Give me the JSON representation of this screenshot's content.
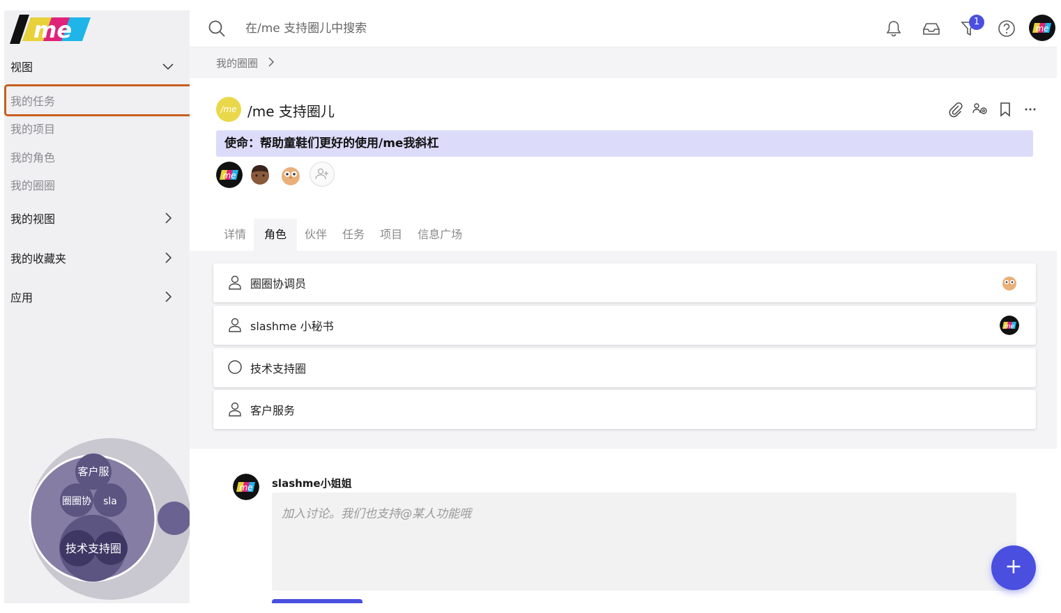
{
  "app": {
    "logo_text": "/me",
    "accent_color": "#4a4fe0",
    "highlight_color": "#c85f1e"
  },
  "sidebar": {
    "views_label": "视图",
    "items": [
      {
        "label": "我的任务"
      },
      {
        "label": "我的项目"
      },
      {
        "label": "我的角色"
      },
      {
        "label": "我的圈圈"
      }
    ],
    "my_views_label": "我的视图",
    "favorites_label": "我的收藏夹",
    "apps_label": "应用",
    "bubble_chart": {
      "labels": [
        "客户服",
        "圈圈协",
        "sla",
        "技术支持圈"
      ]
    }
  },
  "topbar": {
    "search_placeholder": "在/me 支持圈儿中搜索",
    "notification_count": "1",
    "icons": [
      "bell-icon",
      "inbox-icon",
      "filter-icon",
      "help-icon",
      "user-avatar"
    ]
  },
  "breadcrumb": {
    "label": "我的圈圈"
  },
  "circle": {
    "badge_text": "/me",
    "title": "/me 支持圈儿",
    "mission": "使命：帮助童鞋们更好的使用/me我斜杠"
  },
  "tabs": [
    {
      "label": "详情"
    },
    {
      "label": "角色"
    },
    {
      "label": "伙伴"
    },
    {
      "label": "任务"
    },
    {
      "label": "项目"
    },
    {
      "label": "信息广场"
    }
  ],
  "roles": [
    {
      "label": "圈圈协调员",
      "icon": "person-icon",
      "assignee": "owl-avatar"
    },
    {
      "label": "slashme 小秘书",
      "icon": "person-icon",
      "assignee": "me-avatar"
    },
    {
      "label": "技术支持圈",
      "icon": "circle-icon",
      "assignee": ""
    },
    {
      "label": "客户服务",
      "icon": "person-icon",
      "assignee": ""
    }
  ],
  "comment": {
    "author": "slashme小姐姐",
    "placeholder": "加入讨论。我们也支持@某人功能哦"
  },
  "fab": {
    "label": "+"
  }
}
